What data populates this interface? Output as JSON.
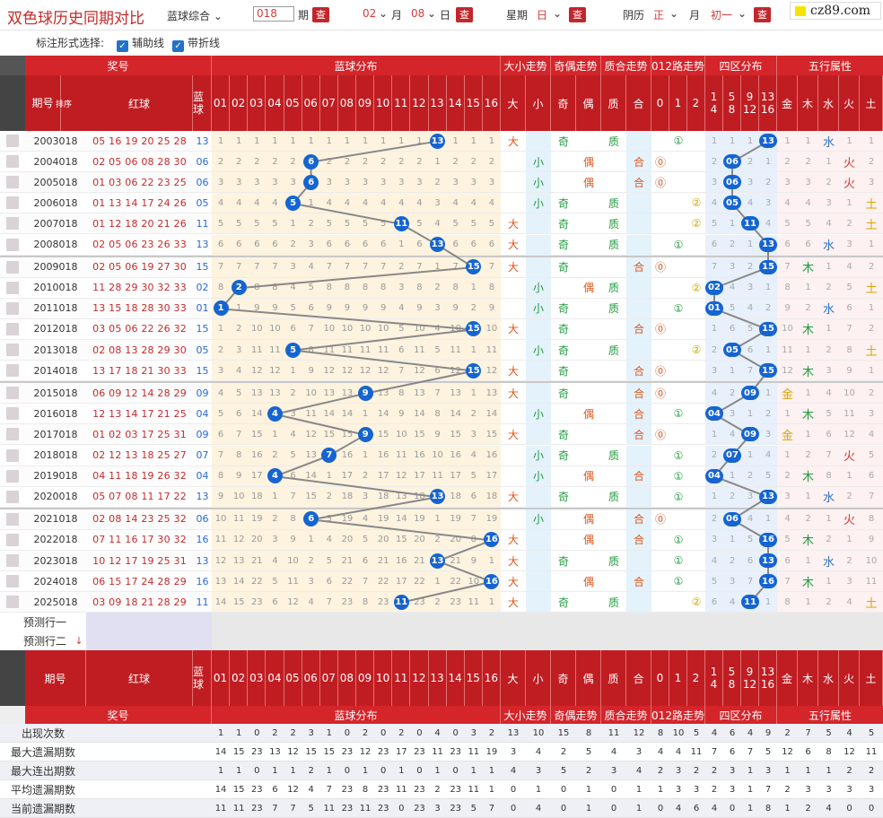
{
  "app_title": "双色球历史同期对比",
  "toolbar": {
    "mode_select": "蓝球综合",
    "period_value": "018",
    "period_label": "期",
    "query_label": "查",
    "month_value": "02",
    "month_label": "月",
    "day_value": "08",
    "day_label": "日",
    "week_label": "星期",
    "week_value": "日",
    "lunar_label": "阴历",
    "lunar_month_value": "正",
    "lunar_month_label": "月",
    "lunar_day_value": "初一"
  },
  "logo_text": "cz89.com",
  "options": {
    "label": "标注形式选择:",
    "opt1": "辅助线",
    "opt2": "带折线"
  },
  "header": {
    "jianghao": "奖号",
    "blue_dist": "蓝球分布",
    "daxiao": "大小走势",
    "jiou": "奇偶走势",
    "zhihe": "质合走势",
    "lu012": "012路走势",
    "siqu": "四区分布",
    "wuxing": "五行属性",
    "qihao": "期号",
    "paixu": "排序",
    "hongqiu": "红球",
    "lanqiu": "蓝球",
    "nums": [
      "01",
      "02",
      "03",
      "04",
      "05",
      "06",
      "07",
      "08",
      "09",
      "10",
      "11",
      "12",
      "13",
      "14",
      "15",
      "16"
    ],
    "dx": [
      "大",
      "小"
    ],
    "jo": [
      "奇",
      "偶"
    ],
    "zh": [
      "质",
      "合"
    ],
    "lu": [
      "0",
      "1",
      "2"
    ],
    "qu": [
      "1|4",
      "5|8",
      "9|12",
      "13|16"
    ],
    "wx": [
      "金",
      "木",
      "水",
      "火",
      "土"
    ]
  },
  "rows": [
    {
      "period": "2003018",
      "red": "05 16 19 20 25 28",
      "blue": "13",
      "miss": [
        1,
        1,
        1,
        1,
        1,
        1,
        1,
        1,
        1,
        1,
        1,
        1,
        0,
        1,
        1,
        1
      ],
      "dx": "大",
      "jo": "奇",
      "zh": "质",
      "lu": "①",
      "qu": [
        1,
        1,
        1,
        "13"
      ],
      "wx": [
        1,
        1,
        "水",
        1,
        1
      ]
    },
    {
      "period": "2004018",
      "red": "02 05 06 08 28 30",
      "blue": "06",
      "miss": [
        2,
        2,
        2,
        2,
        2,
        0,
        2,
        2,
        2,
        2,
        2,
        2,
        1,
        2,
        2,
        2
      ],
      "dx": "小",
      "jo": "偶",
      "zh": "合",
      "lu": "⓪",
      "qu": [
        2,
        "06",
        2,
        1
      ],
      "wx": [
        2,
        2,
        1,
        "火",
        2
      ]
    },
    {
      "period": "2005018",
      "red": "01 03 06 22 23 25",
      "blue": "06",
      "miss": [
        3,
        3,
        3,
        3,
        3,
        0,
        3,
        3,
        3,
        3,
        3,
        3,
        2,
        3,
        3,
        3
      ],
      "dx": "小",
      "jo": "偶",
      "zh": "合",
      "lu": "⓪",
      "qu": [
        3,
        "06",
        3,
        2
      ],
      "wx": [
        3,
        3,
        2,
        "火",
        3
      ]
    },
    {
      "period": "2006018",
      "red": "01 13 14 17 24 26",
      "blue": "05",
      "miss": [
        4,
        4,
        4,
        4,
        0,
        1,
        4,
        4,
        4,
        4,
        4,
        4,
        3,
        4,
        4,
        4
      ],
      "dx": "小",
      "jo": "奇",
      "zh": "质",
      "lu": "②",
      "qu": [
        4,
        "05",
        4,
        3
      ],
      "wx": [
        4,
        4,
        3,
        1,
        "土"
      ]
    },
    {
      "period": "2007018",
      "red": "01 12 18 20 21 26",
      "blue": "11",
      "miss": [
        5,
        5,
        5,
        5,
        1,
        2,
        5,
        5,
        5,
        5,
        0,
        5,
        4,
        5,
        5,
        5
      ],
      "dx": "大",
      "jo": "奇",
      "zh": "质",
      "lu": "②",
      "qu": [
        5,
        1,
        "11",
        4
      ],
      "wx": [
        5,
        5,
        4,
        2,
        "土"
      ]
    },
    {
      "period": "2008018",
      "red": "02 05 06 23 26 33",
      "blue": "13",
      "miss": [
        6,
        6,
        6,
        6,
        2,
        3,
        6,
        6,
        6,
        6,
        1,
        6,
        0,
        6,
        6,
        6
      ],
      "dx": "大",
      "jo": "奇",
      "zh": "质",
      "lu": "①",
      "qu": [
        6,
        2,
        1,
        "13"
      ],
      "wx": [
        6,
        6,
        "水",
        3,
        1
      ]
    },
    {
      "period": "2009018",
      "red": "02 05 06 19 27 30",
      "blue": "15",
      "miss": [
        7,
        7,
        7,
        7,
        3,
        4,
        7,
        7,
        7,
        7,
        2,
        7,
        1,
        7,
        0,
        7
      ],
      "dx": "大",
      "jo": "奇",
      "zh": "合",
      "lu": "⓪",
      "qu": [
        7,
        3,
        2,
        "15"
      ],
      "wx": [
        7,
        "木",
        1,
        4,
        2
      ]
    },
    {
      "period": "2010018",
      "red": "11 28 29 30 32 33",
      "blue": "02",
      "miss": [
        8,
        0,
        8,
        8,
        4,
        5,
        8,
        8,
        8,
        8,
        3,
        8,
        2,
        8,
        1,
        8
      ],
      "dx": "小",
      "jo": "偶",
      "zh": "质",
      "lu": "②",
      "qu": [
        "02",
        4,
        3,
        1
      ],
      "wx": [
        8,
        1,
        2,
        5,
        "土"
      ]
    },
    {
      "period": "2011018",
      "red": "13 15 18 28 30 33",
      "blue": "01",
      "miss": [
        0,
        1,
        9,
        9,
        5,
        6,
        9,
        9,
        9,
        9,
        4,
        9,
        3,
        9,
        2,
        9
      ],
      "dx": "小",
      "jo": "奇",
      "zh": "质",
      "lu": "①",
      "qu": [
        "01",
        5,
        4,
        2
      ],
      "wx": [
        9,
        2,
        "水",
        6,
        1
      ]
    },
    {
      "period": "2012018",
      "red": "03 05 06 22 26 32",
      "blue": "15",
      "miss": [
        1,
        2,
        10,
        10,
        6,
        7,
        10,
        10,
        10,
        10,
        5,
        10,
        4,
        10,
        0,
        10
      ],
      "dx": "大",
      "jo": "奇",
      "zh": "合",
      "lu": "⓪",
      "qu": [
        1,
        6,
        5,
        "15"
      ],
      "wx": [
        10,
        "木",
        1,
        7,
        2
      ]
    },
    {
      "period": "2013018",
      "red": "02 08 13 28 29 30",
      "blue": "05",
      "miss": [
        2,
        3,
        11,
        11,
        0,
        8,
        11,
        11,
        11,
        11,
        6,
        11,
        5,
        11,
        1,
        11
      ],
      "dx": "小",
      "jo": "奇",
      "zh": "质",
      "lu": "②",
      "qu": [
        2,
        "05",
        6,
        1
      ],
      "wx": [
        11,
        1,
        2,
        8,
        "土"
      ]
    },
    {
      "period": "2014018",
      "red": "13 17 18 21 30 33",
      "blue": "15",
      "miss": [
        3,
        4,
        12,
        12,
        1,
        9,
        12,
        12,
        12,
        12,
        7,
        12,
        6,
        12,
        0,
        12
      ],
      "dx": "大",
      "jo": "奇",
      "zh": "合",
      "lu": "⓪",
      "qu": [
        3,
        1,
        7,
        "15"
      ],
      "wx": [
        12,
        "木",
        3,
        9,
        1
      ]
    },
    {
      "period": "2015018",
      "red": "06 09 12 14 28 29",
      "blue": "09",
      "miss": [
        4,
        5,
        13,
        13,
        2,
        10,
        13,
        13,
        0,
        13,
        8,
        13,
        7,
        13,
        1,
        13
      ],
      "dx": "大",
      "jo": "奇",
      "zh": "合",
      "lu": "⓪",
      "qu": [
        4,
        2,
        "09",
        1
      ],
      "wx": [
        "金",
        1,
        4,
        10,
        2
      ]
    },
    {
      "period": "2016018",
      "red": "12 13 14 17 21 25",
      "blue": "04",
      "miss": [
        5,
        6,
        14,
        0,
        3,
        11,
        14,
        14,
        1,
        14,
        9,
        14,
        8,
        14,
        2,
        14
      ],
      "dx": "小",
      "jo": "偶",
      "zh": "合",
      "lu": "①",
      "qu": [
        "04",
        3,
        1,
        2
      ],
      "wx": [
        1,
        "木",
        5,
        11,
        3
      ]
    },
    {
      "period": "2017018",
      "red": "01 02 03 17 25 31",
      "blue": "09",
      "miss": [
        6,
        7,
        15,
        1,
        4,
        12,
        15,
        15,
        0,
        15,
        10,
        15,
        9,
        15,
        3,
        15
      ],
      "dx": "大",
      "jo": "奇",
      "zh": "合",
      "lu": "⓪",
      "qu": [
        1,
        4,
        "09",
        3
      ],
      "wx": [
        "金",
        1,
        6,
        12,
        4
      ]
    },
    {
      "period": "2018018",
      "red": "02 12 13 18 25 27",
      "blue": "07",
      "miss": [
        7,
        8,
        16,
        2,
        5,
        13,
        0,
        16,
        1,
        16,
        11,
        16,
        10,
        16,
        4,
        16
      ],
      "dx": "小",
      "jo": "奇",
      "zh": "质",
      "lu": "①",
      "qu": [
        2,
        "07",
        1,
        4
      ],
      "wx": [
        1,
        2,
        7,
        "火",
        5
      ]
    },
    {
      "period": "2019018",
      "red": "04 11 18 19 26 32",
      "blue": "04",
      "miss": [
        8,
        9,
        17,
        0,
        6,
        14,
        1,
        17,
        2,
        17,
        12,
        17,
        11,
        17,
        5,
        17
      ],
      "dx": "小",
      "jo": "偶",
      "zh": "合",
      "lu": "①",
      "qu": [
        "04",
        1,
        2,
        5
      ],
      "wx": [
        2,
        "木",
        8,
        1,
        6
      ]
    },
    {
      "period": "2020018",
      "red": "05 07 08 11 17 22",
      "blue": "13",
      "miss": [
        9,
        10,
        18,
        1,
        7,
        15,
        2,
        18,
        3,
        18,
        13,
        18,
        0,
        18,
        6,
        18
      ],
      "dx": "大",
      "jo": "奇",
      "zh": "质",
      "lu": "①",
      "qu": [
        1,
        2,
        3,
        "13"
      ],
      "wx": [
        3,
        1,
        "水",
        2,
        7
      ]
    },
    {
      "period": "2021018",
      "red": "02 08 14 23 25 32",
      "blue": "06",
      "miss": [
        10,
        11,
        19,
        2,
        8,
        0,
        3,
        19,
        4,
        19,
        14,
        19,
        1,
        19,
        7,
        19
      ],
      "dx": "小",
      "jo": "偶",
      "zh": "合",
      "lu": "⓪",
      "qu": [
        2,
        "06",
        4,
        1
      ],
      "wx": [
        4,
        2,
        1,
        "火",
        8
      ]
    },
    {
      "period": "2022018",
      "red": "07 11 16 17 30 32",
      "blue": "16",
      "miss": [
        11,
        12,
        20,
        3,
        9,
        1,
        4,
        20,
        5,
        20,
        15,
        20,
        2,
        20,
        8,
        0
      ],
      "dx": "大",
      "jo": "偶",
      "zh": "合",
      "lu": "①",
      "qu": [
        3,
        1,
        5,
        "16"
      ],
      "wx": [
        5,
        "木",
        2,
        1,
        9
      ]
    },
    {
      "period": "2023018",
      "red": "10 12 17 19 25 31",
      "blue": "13",
      "miss": [
        12,
        13,
        21,
        4,
        10,
        2,
        5,
        21,
        6,
        21,
        16,
        21,
        0,
        21,
        9,
        1
      ],
      "dx": "大",
      "jo": "奇",
      "zh": "质",
      "lu": "①",
      "qu": [
        4,
        2,
        6,
        "13"
      ],
      "wx": [
        6,
        1,
        "水",
        2,
        10
      ]
    },
    {
      "period": "2024018",
      "red": "06 15 17 24 28 29",
      "blue": "16",
      "miss": [
        13,
        14,
        22,
        5,
        11,
        3,
        6,
        22,
        7,
        22,
        17,
        22,
        1,
        22,
        10,
        0
      ],
      "dx": "大",
      "jo": "偶",
      "zh": "合",
      "lu": "①",
      "qu": [
        5,
        3,
        7,
        "16"
      ],
      "wx": [
        7,
        "木",
        1,
        3,
        11
      ]
    },
    {
      "period": "2025018",
      "red": "03 09 18 21 28 29",
      "blue": "11",
      "miss": [
        14,
        15,
        23,
        6,
        12,
        4,
        7,
        23,
        8,
        23,
        0,
        23,
        2,
        23,
        11,
        1
      ],
      "dx": "大",
      "jo": "奇",
      "zh": "质",
      "lu": "②",
      "qu": [
        6,
        4,
        "11",
        1
      ],
      "wx": [
        8,
        1,
        2,
        4,
        "土"
      ]
    }
  ],
  "predict": [
    "预测行一",
    "预测行二"
  ],
  "stats": [
    {
      "label": "出现次数",
      "vals": [
        1,
        1,
        0,
        2,
        2,
        3,
        1,
        0,
        2,
        0,
        2,
        0,
        4,
        0,
        3,
        2,
        13,
        10,
        15,
        8,
        11,
        12,
        8,
        10,
        5,
        4,
        6,
        4,
        9,
        2,
        7,
        5,
        4,
        5
      ]
    },
    {
      "label": "最大遗漏期数",
      "vals": [
        14,
        15,
        23,
        13,
        12,
        15,
        15,
        23,
        12,
        23,
        17,
        23,
        11,
        23,
        11,
        19,
        3,
        4,
        2,
        5,
        4,
        3,
        4,
        4,
        11,
        7,
        6,
        7,
        5,
        12,
        6,
        8,
        12,
        11
      ]
    },
    {
      "label": "最大连出期数",
      "vals": [
        1,
        1,
        0,
        1,
        1,
        2,
        1,
        0,
        1,
        0,
        1,
        0,
        1,
        0,
        1,
        1,
        4,
        3,
        5,
        2,
        3,
        4,
        2,
        3,
        2,
        2,
        3,
        1,
        3,
        1,
        1,
        1,
        2,
        2
      ]
    },
    {
      "label": "平均遗漏期数",
      "vals": [
        14,
        15,
        23,
        6,
        12,
        4,
        7,
        23,
        8,
        23,
        11,
        23,
        2,
        23,
        11,
        1,
        0,
        1,
        0,
        1,
        0,
        1,
        1,
        3,
        3,
        2,
        3,
        1,
        7,
        2,
        3,
        3,
        3,
        3
      ]
    },
    {
      "label": "当前遗漏期数",
      "vals": [
        11,
        11,
        23,
        7,
        7,
        5,
        11,
        23,
        11,
        23,
        0,
        23,
        3,
        23,
        5,
        7,
        0,
        4,
        0,
        1,
        0,
        1,
        0,
        4,
        6,
        4,
        0,
        1,
        8,
        1,
        2,
        4,
        0,
        0
      ]
    }
  ],
  "colors": {
    "header_red": "#d4252b",
    "blue_ball": "#1564d2",
    "da": "#e2551a",
    "xiao": "#1f9a3c",
    "ji": "#1f9a3c",
    "ou": "#e2551a",
    "zhi": "#1f9a3c",
    "he": "#e2551a",
    "jin": "#d8a400",
    "mu": "#1f9a3c",
    "shui": "#2a72c8",
    "huo": "#d53b3b",
    "tu": "#d8a400"
  }
}
